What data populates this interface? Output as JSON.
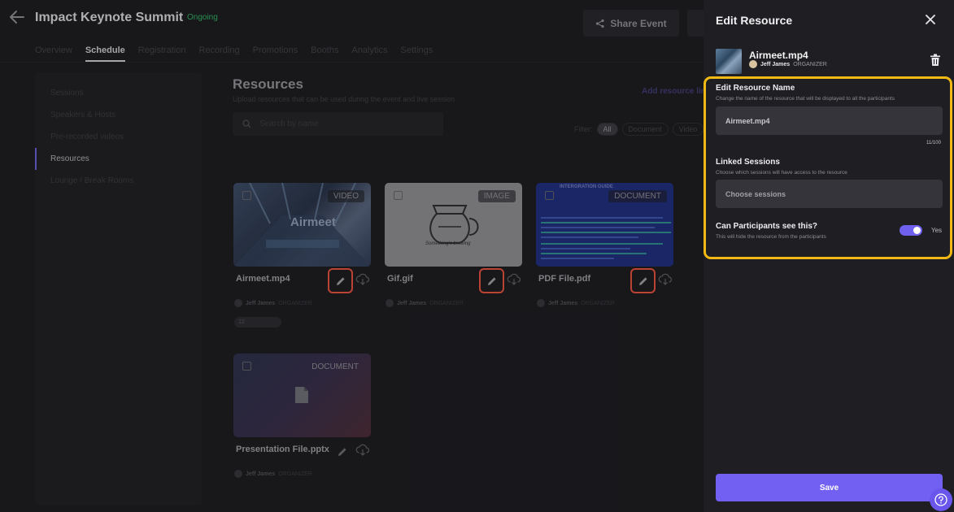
{
  "header": {
    "event_title": "Impact Keynote Summit",
    "status": "Ongoing",
    "share_label": "Share Event",
    "tabs": [
      "Overview",
      "Schedule",
      "Registration",
      "Recording",
      "Promotions",
      "Booths",
      "Analytics",
      "Settings"
    ]
  },
  "sidebar": {
    "items": [
      "Sessions",
      "Speakers & Hosts",
      "Pre-recorded videos",
      "Resources",
      "Lounge / Break Rooms"
    ]
  },
  "resources": {
    "title": "Resources",
    "subtitle": "Upload resources that can be used during the event and live session",
    "add_link": "Add resource link",
    "search_placeholder": "Search by name",
    "filter_label": "Filter:",
    "filters": [
      "All",
      "Document",
      "Video"
    ],
    "cards": [
      {
        "name": "Airmeet.mp4",
        "badge": "VIDEO",
        "owner": "Jeff James",
        "role": "ORGANIZER",
        "count": "12",
        "thumb_word": "Airmeet"
      },
      {
        "name": "Gif.gif",
        "badge": "IMAGE",
        "owner": "Jeff James",
        "role": "ORGANIZER",
        "thumb_caption": "Something's brewing"
      },
      {
        "name": "PDF File.pdf",
        "badge": "DOCUMENT",
        "owner": "Jeff James",
        "role": "ORGANIZER",
        "thumb_heading": "INTERGRATION GUIDE"
      },
      {
        "name": "Presentation File.pptx",
        "badge": "DOCUMENT",
        "owner": "Jeff James",
        "role": "ORGANIZER"
      }
    ]
  },
  "panel": {
    "title": "Edit Resource",
    "resource_name": "Airmeet.mp4",
    "owner": "Jeff James",
    "role": "ORGANIZER",
    "name_field": {
      "label": "Edit Resource Name",
      "help": "Change the name of the resource that will be displayed to all the participants",
      "value": "Airmeet.mp4",
      "counter": "11/100"
    },
    "sessions_field": {
      "label": "Linked Sessions",
      "help": "Choose which sessions will have access to the resource",
      "placeholder": "Choose sessions"
    },
    "visibility": {
      "label": "Can Participants see this?",
      "help": "This will hide the resource from the participants",
      "toggle_label": "Yes",
      "enabled": true
    },
    "save_label": "Save"
  },
  "colors": {
    "accent": "#7260f2",
    "highlight": "#f2b915",
    "edit_highlight": "#e2503c",
    "ongoing": "#2fae62"
  }
}
